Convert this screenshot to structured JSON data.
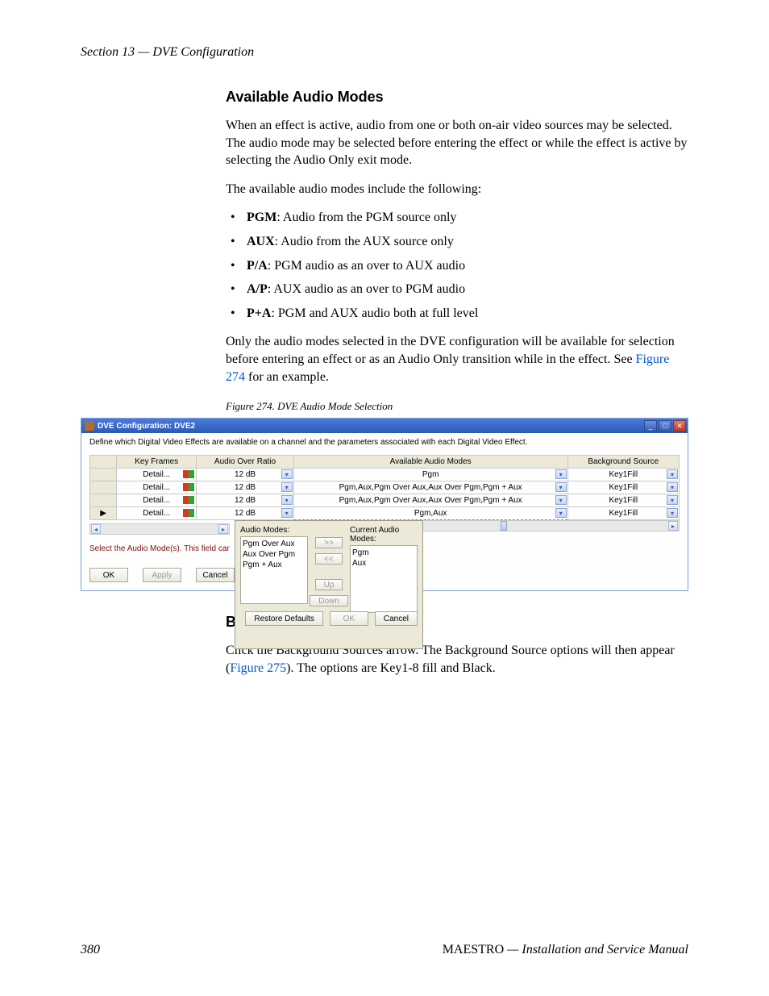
{
  "running_header": "Section 13 — DVE Configuration",
  "h_modes": "Available Audio Modes",
  "p1": "When an effect is active, audio from one or both on-air video sources may be selected. The audio mode may be selected before entering the effect or while the effect is active by selecting the Audio Only exit mode.",
  "p2": "The available audio modes include the following:",
  "modes": [
    {
      "k": "PGM",
      "v": ": Audio from the PGM source only"
    },
    {
      "k": "AUX",
      "v": ": Audio from the AUX source only"
    },
    {
      "k": "P/A",
      "v": ": PGM audio as an over to AUX audio"
    },
    {
      "k": "A/P",
      "v": ": AUX audio as an over to PGM audio"
    },
    {
      "k": "P+A",
      "v": ": PGM and AUX audio both at full level"
    }
  ],
  "p3a": "Only the audio modes selected in the DVE configuration will be available for selection before entering an effect or as an Audio Only transition while in the effect. See ",
  "p3_link": "Figure 274",
  "p3b": " for an example.",
  "fig_caption": "Figure 274.  DVE Audio Mode Selection",
  "h_bg": "Background Sources",
  "p4a": "Click the Background Sources arrow. The Background Source options will then appear (",
  "p4_link": "Figure 275",
  "p4b": "). The options are Key1-8 fill and Black.",
  "footer_page": "380",
  "footer_right_prod": "MAESTRO",
  "footer_right_rest": "  —  Installation and Service Manual",
  "win": {
    "title": "DVE Configuration: DVE2",
    "desc": "Define which Digital Video Effects are available on a channel and the parameters associated with each Digital Video Effect.",
    "headers": {
      "kf": "Key Frames",
      "ratio": "Audio Over Ratio",
      "modes": "Available Audio Modes",
      "bg": "Background Source"
    },
    "rows": [
      {
        "play": "",
        "kf": "Detail...",
        "ratio": "12 dB",
        "modes": "Pgm",
        "bg": "Key1Fill"
      },
      {
        "play": "",
        "kf": "Detail...",
        "ratio": "12 dB",
        "modes": "Pgm,Aux,Pgm Over Aux,Aux Over Pgm,Pgm + Aux",
        "bg": "Key1Fill"
      },
      {
        "play": "",
        "kf": "Detail...",
        "ratio": "12 dB",
        "modes": "Pgm,Aux,Pgm Over Aux,Aux Over Pgm,Pgm + Aux",
        "bg": "Key1Fill"
      },
      {
        "play": "▶",
        "kf": "Detail...",
        "ratio": "12 dB",
        "modes": "Pgm,Aux",
        "bg": "Key1Fill"
      }
    ],
    "hint": "Select the Audio Mode(s). This field cannot be bl",
    "actions": {
      "ok": "OK",
      "apply": "Apply",
      "cancel": "Cancel"
    },
    "popout": {
      "lbl_left": "Audio Modes:",
      "lbl_right": "Current Audio Modes:",
      "left": [
        "Pgm Over Aux",
        "Aux Over Pgm",
        "Pgm + Aux"
      ],
      "right": [
        "Pgm",
        "Aux"
      ],
      "btn_add": ">>",
      "btn_rem": "<<",
      "btn_up": "Up",
      "btn_dn": "Down",
      "btn_restore": "Restore Defaults",
      "btn_ok": "OK",
      "btn_cancel": "Cancel"
    }
  }
}
